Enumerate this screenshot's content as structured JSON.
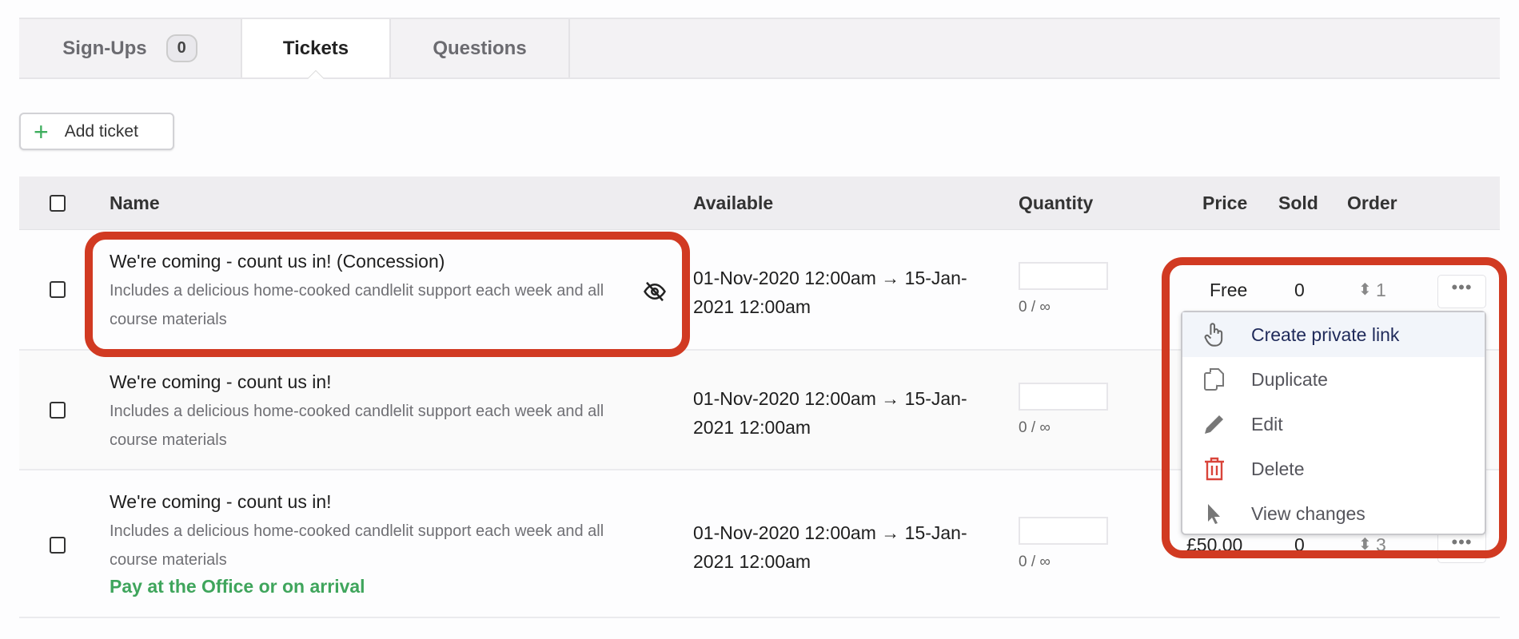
{
  "tabs": [
    {
      "label": "Sign-Ups",
      "badge": "0"
    },
    {
      "label": "Tickets"
    },
    {
      "label": "Questions"
    }
  ],
  "toolbar": {
    "add_ticket": "Add ticket"
  },
  "table": {
    "headers": {
      "name": "Name",
      "available": "Available",
      "quantity": "Quantity",
      "price": "Price",
      "sold": "Sold",
      "order": "Order"
    },
    "rows": [
      {
        "name": "We're coming - count us in! (Concession)",
        "description": "Includes a delicious home-cooked candlelit support each week and all course materials",
        "available": "01-Nov-2020 12:00am → 15-Jan-2021 12:00am",
        "quantity_value": "",
        "quantity_label": "0 / ∞",
        "price": "Free",
        "sold": "0",
        "order": "1",
        "hidden": true
      },
      {
        "name": "We're coming - count us in!",
        "description": "Includes a delicious home-cooked candlelit support each week and all course materials",
        "available": "01-Nov-2020 12:00am → 15-Jan-2021 12:00am",
        "quantity_value": "",
        "quantity_label": "0 / ∞"
      },
      {
        "name": "We're coming - count us in!",
        "description": "Includes a delicious home-cooked candlelit support each week and all course materials",
        "note": "Pay at the Office or on arrival",
        "available": "01-Nov-2020 12:00am → 15-Jan-2021 12:00am",
        "quantity_value": "",
        "quantity_label": "0 / ∞",
        "price": "£50.00",
        "sold": "0",
        "order": "3"
      }
    ]
  },
  "menu": {
    "more_label": "•••",
    "items": [
      {
        "label": "Create private link",
        "icon": "hand-pointer-icon"
      },
      {
        "label": "Duplicate",
        "icon": "copy-icon"
      },
      {
        "label": "Edit",
        "icon": "pencil-icon"
      },
      {
        "label": "Delete",
        "icon": "trash-icon"
      },
      {
        "label": "View changes",
        "icon": "cursor-icon"
      }
    ]
  },
  "colors": {
    "highlight": "#d13a22",
    "green": "#3fae5e",
    "delete": "#d9443a"
  }
}
